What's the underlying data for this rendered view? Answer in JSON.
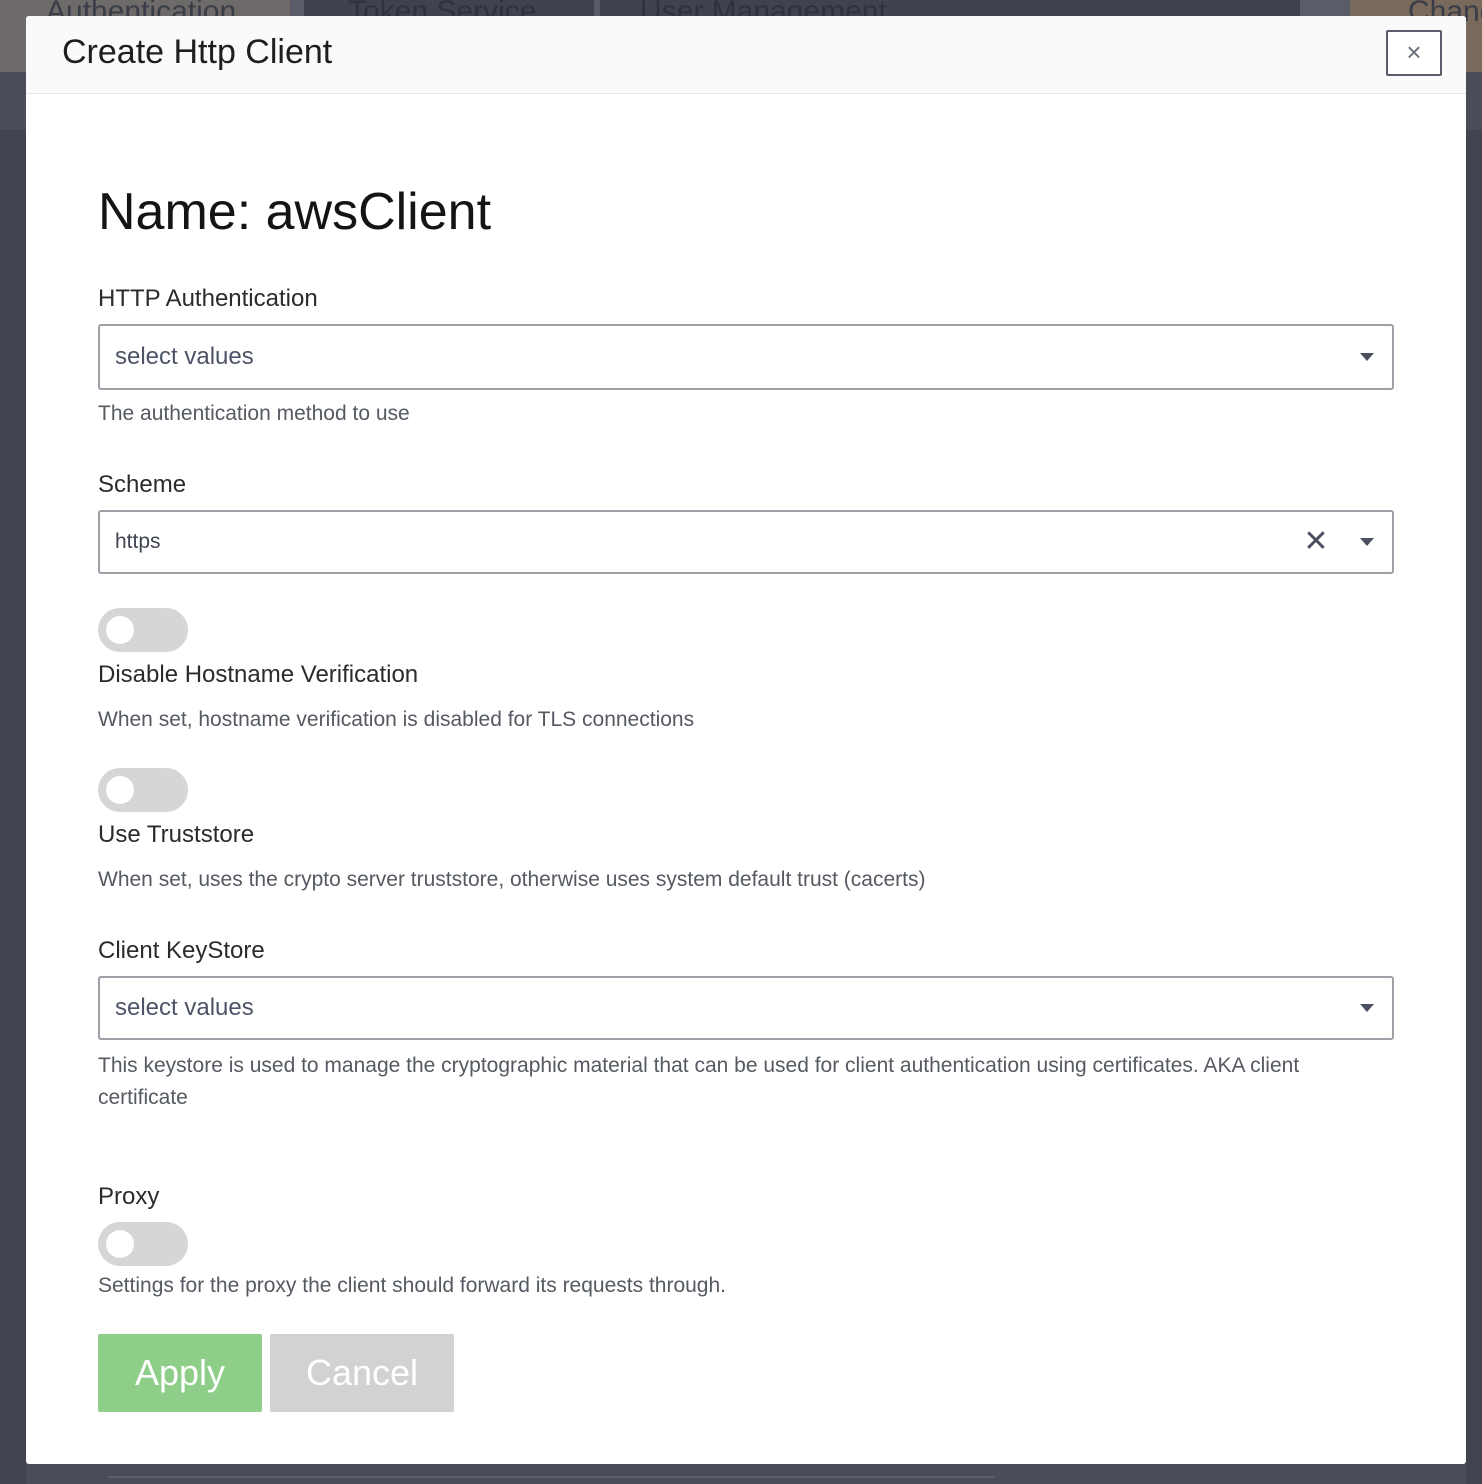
{
  "background": {
    "tabs": [
      "Authentication",
      "Token Service",
      "User Management",
      "Chang"
    ]
  },
  "modal": {
    "title": "Create Http Client",
    "close_label": "×",
    "name_heading": "Name: awsClient",
    "http_auth": {
      "label": "HTTP Authentication",
      "placeholder": "select values",
      "help": "The authentication method to use"
    },
    "scheme": {
      "label": "Scheme",
      "value": "https",
      "clear_label": "✕"
    },
    "disable_hostname": {
      "label": "Disable Hostname Verification",
      "help": "When set, hostname verification is disabled for TLS connections",
      "enabled": false
    },
    "use_truststore": {
      "label": "Use Truststore",
      "help": "When set, uses the crypto server truststore, otherwise uses system default trust (cacerts)",
      "enabled": false
    },
    "client_keystore": {
      "label": "Client KeyStore",
      "placeholder": "select values",
      "help": "This keystore is used to manage the cryptographic material that can be used for client authentication using certificates. AKA client certificate"
    },
    "proxy": {
      "label": "Proxy",
      "help": "Settings for the proxy the client should forward its requests through.",
      "enabled": false
    },
    "buttons": {
      "apply": "Apply",
      "cancel": "Cancel"
    }
  },
  "colors": {
    "apply_button": "#8fce88",
    "cancel_button": "#d2d2d2",
    "toggle_off": "#d6d6d6"
  }
}
